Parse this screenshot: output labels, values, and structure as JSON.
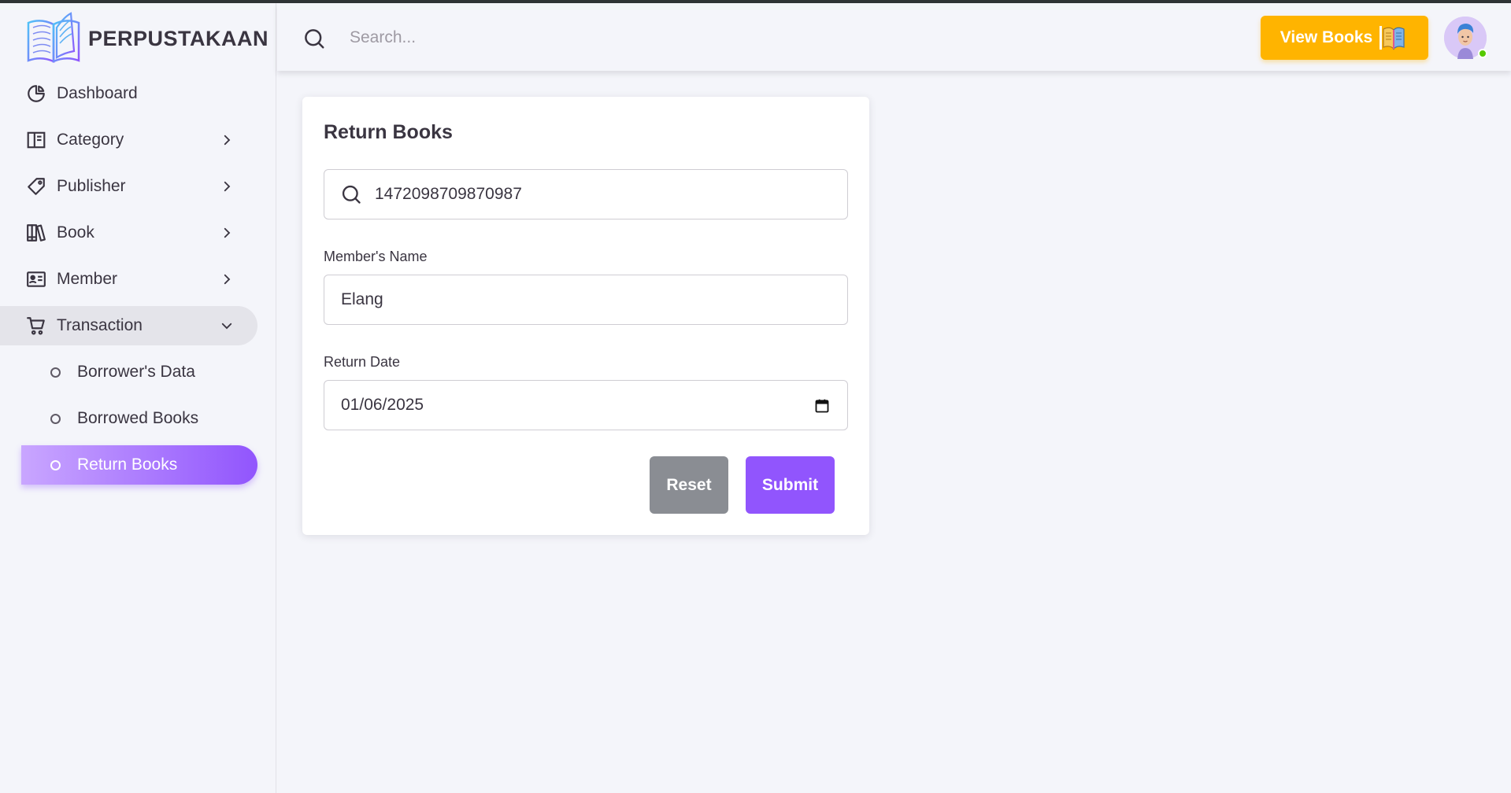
{
  "brand": {
    "name": "PERPUSTAKAAN"
  },
  "sidebar": {
    "items": [
      {
        "label": "Dashboard",
        "icon": "pie-chart-icon",
        "has_chevron": false
      },
      {
        "label": "Category",
        "icon": "layout-icon",
        "has_chevron": true
      },
      {
        "label": "Publisher",
        "icon": "tag-icon",
        "has_chevron": true
      },
      {
        "label": "Book",
        "icon": "books-icon",
        "has_chevron": true
      },
      {
        "label": "Member",
        "icon": "id-card-icon",
        "has_chevron": true
      },
      {
        "label": "Transaction",
        "icon": "cart-icon",
        "has_chevron": true,
        "expanded": true
      }
    ],
    "sub_items": [
      {
        "label": "Borrower's Data",
        "active": false
      },
      {
        "label": "Borrowed Books",
        "active": false
      },
      {
        "label": "Return Books",
        "active": true
      }
    ]
  },
  "topbar": {
    "search_placeholder": "Search...",
    "view_books_label": "View Books",
    "status": "online"
  },
  "form": {
    "title": "Return Books",
    "search_value": "1472098709870987",
    "member_name_label": "Member's Name",
    "member_name_value": "Elang",
    "return_date_label": "Return Date",
    "return_date_value": "01/06/2025",
    "reset_label": "Reset",
    "submit_label": "Submit"
  },
  "colors": {
    "primary": "#9155fd",
    "warning": "#ffb400",
    "secondary": "#8a8d93",
    "background": "#f4f5fa"
  }
}
